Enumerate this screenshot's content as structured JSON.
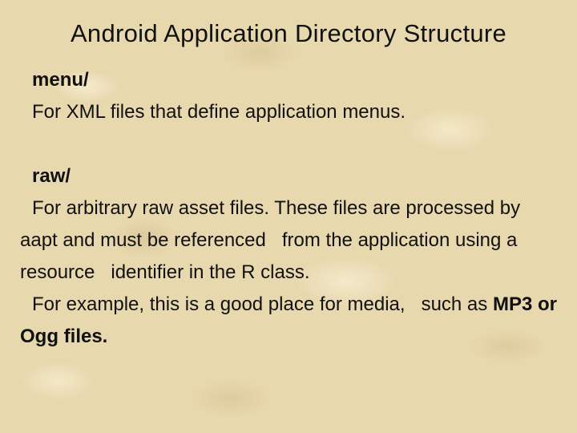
{
  "slide": {
    "title": "Android Application Directory Structure",
    "sections": [
      {
        "label": "menu/",
        "paragraphs": [
          {
            "text": "For XML files that define application menus."
          }
        ]
      },
      {
        "label": "raw/",
        "paragraphs": [
          {
            "text": "For arbitrary raw asset files. These files are processed by aapt and must be referenced   from the application using a resource   identifier in the R class."
          },
          {
            "text_before": "For example, this is a good place for media,   such as ",
            "text_bold": "MP3 or Ogg files."
          }
        ]
      }
    ]
  }
}
